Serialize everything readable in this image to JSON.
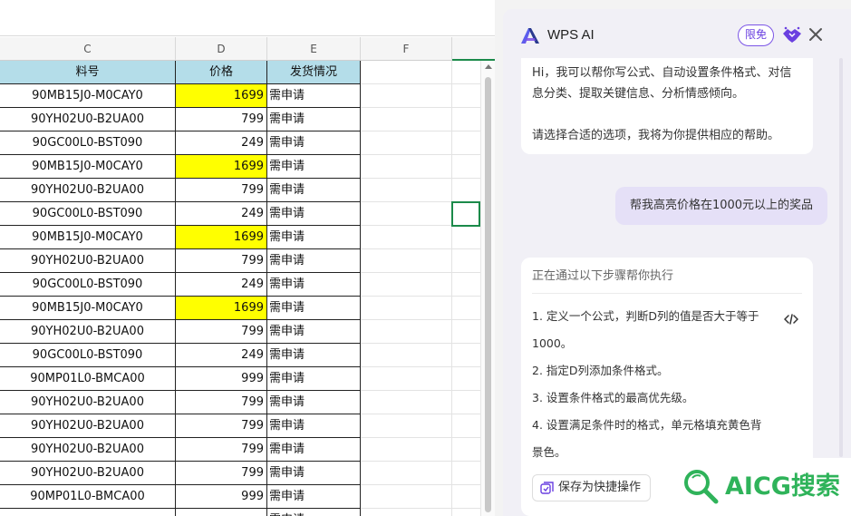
{
  "sheet": {
    "columns": [
      "C",
      "D",
      "E",
      "F"
    ],
    "header": {
      "part_no": "料号",
      "price": "价格",
      "shipping": "发货情况"
    },
    "rows": [
      {
        "part_no": "90MB15J0-M0CAY0",
        "price": "1699",
        "shipping": "需申请",
        "highlight": true
      },
      {
        "part_no": "90YH02U0-B2UA00",
        "price": "799",
        "shipping": "需申请",
        "highlight": false
      },
      {
        "part_no": "90GC00L0-BST090",
        "price": "249",
        "shipping": "需申请",
        "highlight": false
      },
      {
        "part_no": "90MB15J0-M0CAY0",
        "price": "1699",
        "shipping": "需申请",
        "highlight": true
      },
      {
        "part_no": "90YH02U0-B2UA00",
        "price": "799",
        "shipping": "需申请",
        "highlight": false
      },
      {
        "part_no": "90GC00L0-BST090",
        "price": "249",
        "shipping": "需申请",
        "highlight": false
      },
      {
        "part_no": "90MB15J0-M0CAY0",
        "price": "1699",
        "shipping": "需申请",
        "highlight": true
      },
      {
        "part_no": "90YH02U0-B2UA00",
        "price": "799",
        "shipping": "需申请",
        "highlight": false
      },
      {
        "part_no": "90GC00L0-BST090",
        "price": "249",
        "shipping": "需申请",
        "highlight": false
      },
      {
        "part_no": "90MB15J0-M0CAY0",
        "price": "1699",
        "shipping": "需申请",
        "highlight": true
      },
      {
        "part_no": "90YH02U0-B2UA00",
        "price": "799",
        "shipping": "需申请",
        "highlight": false
      },
      {
        "part_no": "90GC00L0-BST090",
        "price": "249",
        "shipping": "需申请",
        "highlight": false
      },
      {
        "part_no": "90MP01L0-BMCA00",
        "price": "999",
        "shipping": "需申请",
        "highlight": false
      },
      {
        "part_no": "90YH02U0-B2UA00",
        "price": "799",
        "shipping": "需申请",
        "highlight": false
      },
      {
        "part_no": "90YH02U0-B2UA00",
        "price": "799",
        "shipping": "需申请",
        "highlight": false
      },
      {
        "part_no": "90YH02U0-B2UA00",
        "price": "799",
        "shipping": "需申请",
        "highlight": false
      },
      {
        "part_no": "90YH02U0-B2UA00",
        "price": "799",
        "shipping": "需申请",
        "highlight": false
      },
      {
        "part_no": "90MP01L0-BMCA00",
        "price": "999",
        "shipping": "需申请",
        "highlight": false
      },
      {
        "part_no": "",
        "price": "",
        "shipping": "需申请",
        "highlight": false
      }
    ]
  },
  "panel": {
    "title": "WPS AI",
    "badge": "限免",
    "intro": {
      "line1": "Hi，我可以帮你写公式、自动设置条件格式、对信息分类、提取关键信息、分析情感倾向。",
      "line2": "请选择合适的选项，我将为你提供相应的帮助。"
    },
    "user_message": "帮我高亮价格在1000元以上的奖品",
    "steps": {
      "title": "正在通过以下步骤帮你执行",
      "items": [
        "1. 定义一个公式，判断D列的值是否大于等于1000。",
        "2. 指定D列添加条件格式。",
        "3. 设置条件格式的最高优先级。",
        "4. 设置满足条件时的格式，单元格填充黄色背景色。"
      ],
      "save_button": "保存为快捷操作"
    }
  },
  "watermark": "AICG搜索",
  "colors": {
    "highlight": "#ffff00",
    "header_fill": "#b4dde9",
    "accent": "#7b55e6",
    "selection": "#1b8a4a"
  }
}
